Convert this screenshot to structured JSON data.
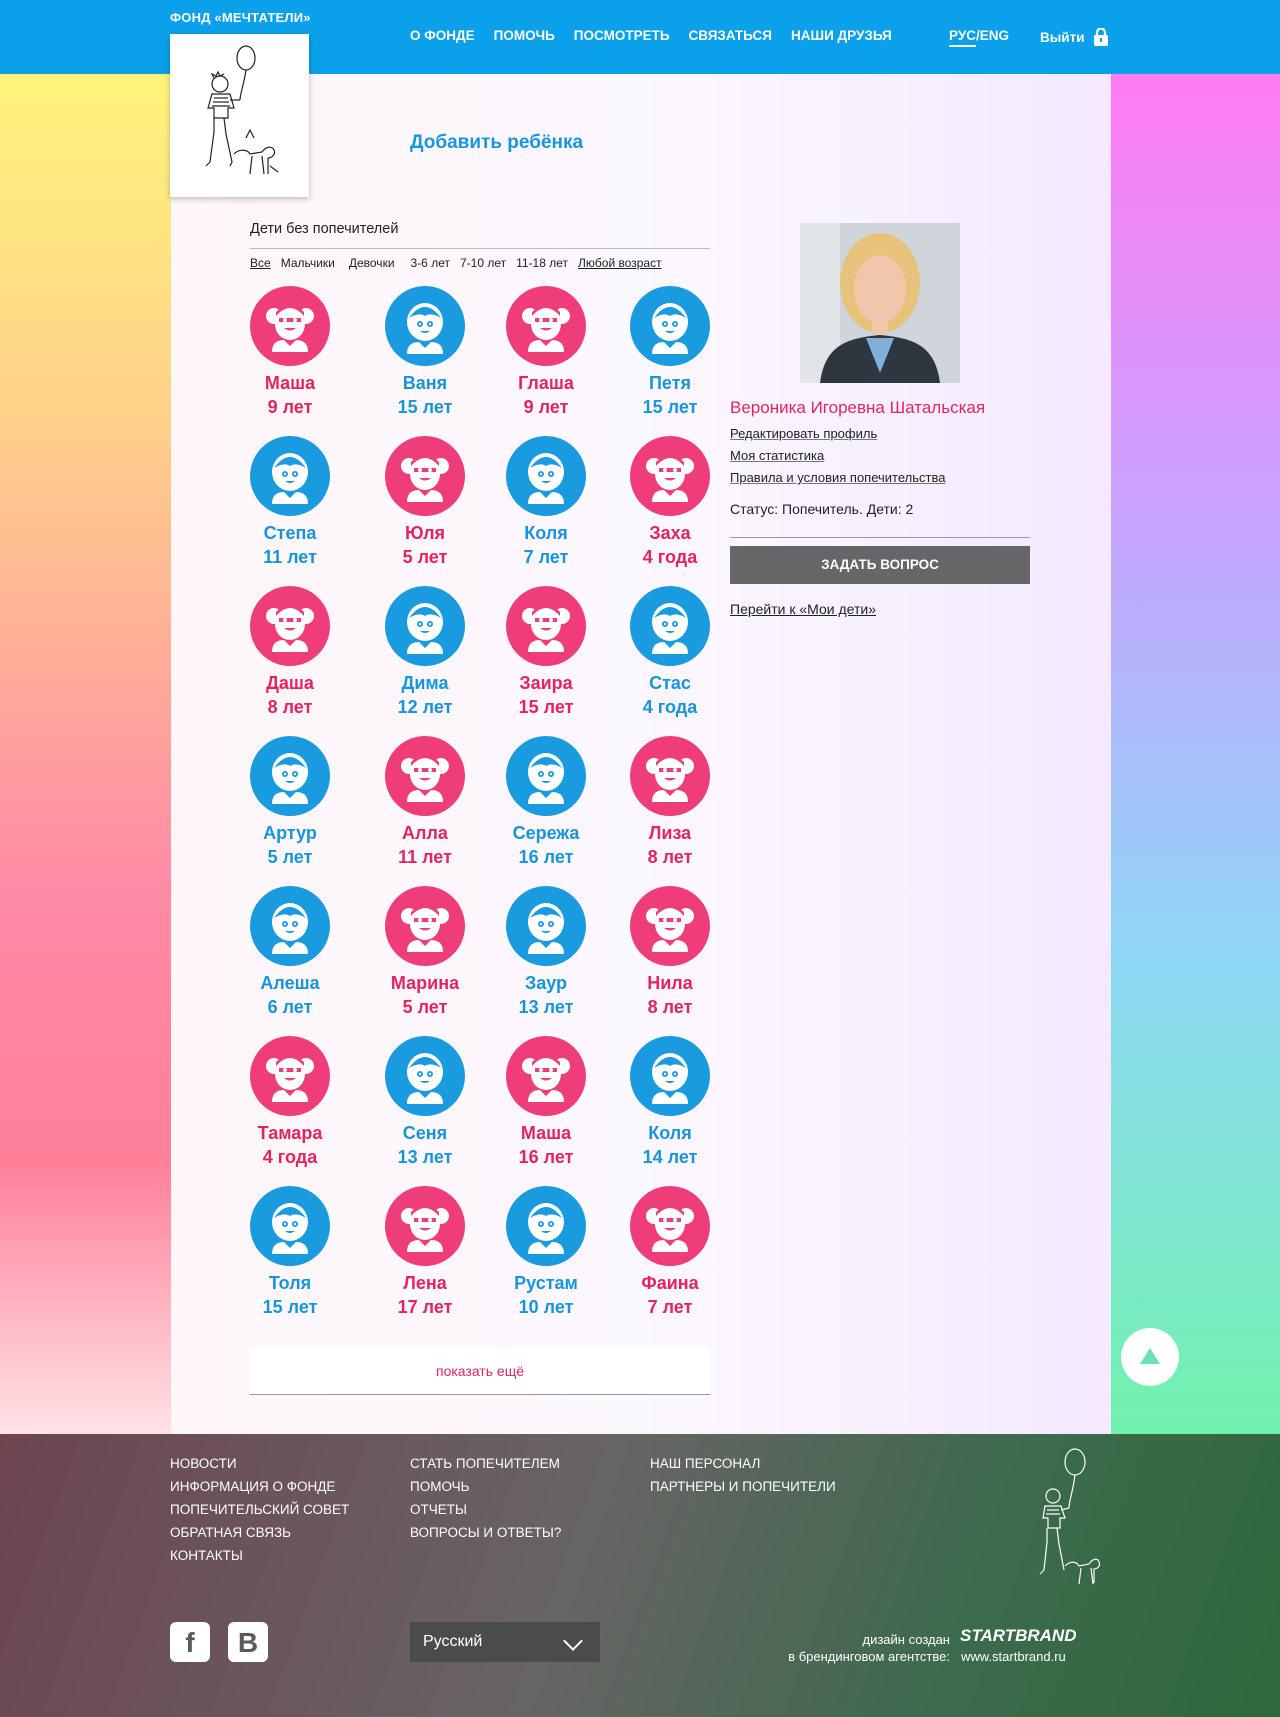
{
  "header": {
    "brand": "ФОНД «МЕЧТАТЕЛИ»",
    "nav": [
      "О ФОНДЕ",
      "ПОМОЧЬ",
      "ПОСМОТРЕТЬ",
      "СВЯЗАТЬСЯ",
      "НАШИ ДРУЗЬЯ"
    ],
    "lang_active": "РУС",
    "lang_sep": "/",
    "lang_other": "ENG",
    "logout": "Выйти"
  },
  "main": {
    "add_child": "Добавить ребёнка",
    "list_title": "Дети без попечителей",
    "filters": [
      "Все",
      "Мальчики",
      "Девочки",
      "3-6 лет",
      "7-10 лет",
      "11-18 лет",
      "Любой возраст"
    ],
    "show_more": "показать ещё"
  },
  "children": [
    {
      "name": "Маша",
      "age": "9 лет",
      "gender": "girl"
    },
    {
      "name": "Ваня",
      "age": "15 лет",
      "gender": "boy"
    },
    {
      "name": "Глаша",
      "age": "9 лет",
      "gender": "girl"
    },
    {
      "name": "Петя",
      "age": "15 лет",
      "gender": "boy"
    },
    {
      "name": "Степа",
      "age": "11 лет",
      "gender": "boy"
    },
    {
      "name": "Юля",
      "age": "5 лет",
      "gender": "girl"
    },
    {
      "name": "Коля",
      "age": "7 лет",
      "gender": "boy"
    },
    {
      "name": "Заха",
      "age": "4 года",
      "gender": "girl"
    },
    {
      "name": "Даша",
      "age": "8 лет",
      "gender": "girl"
    },
    {
      "name": "Дима",
      "age": "12 лет",
      "gender": "boy"
    },
    {
      "name": "Заира",
      "age": "15 лет",
      "gender": "girl"
    },
    {
      "name": "Стас",
      "age": "4 года",
      "gender": "boy"
    },
    {
      "name": "Артур",
      "age": "5 лет",
      "gender": "boy"
    },
    {
      "name": "Алла",
      "age": "11 лет",
      "gender": "girl"
    },
    {
      "name": "Сережа",
      "age": "16 лет",
      "gender": "boy"
    },
    {
      "name": "Лиза",
      "age": "8 лет",
      "gender": "girl"
    },
    {
      "name": "Алеша",
      "age": "6 лет",
      "gender": "boy"
    },
    {
      "name": "Марина",
      "age": "5 лет",
      "gender": "girl"
    },
    {
      "name": "Заур",
      "age": "13 лет",
      "gender": "boy"
    },
    {
      "name": "Нила",
      "age": "8 лет",
      "gender": "girl"
    },
    {
      "name": "Тамара",
      "age": "4 года",
      "gender": "girl"
    },
    {
      "name": "Сеня",
      "age": "13 лет",
      "gender": "boy"
    },
    {
      "name": "Маша",
      "age": "16 лет",
      "gender": "girl"
    },
    {
      "name": "Коля",
      "age": "14 лет",
      "gender": "boy"
    },
    {
      "name": "Толя",
      "age": "15 лет",
      "gender": "boy"
    },
    {
      "name": "Лена",
      "age": "17 лет",
      "gender": "girl"
    },
    {
      "name": "Рустам",
      "age": "10 лет",
      "gender": "boy"
    },
    {
      "name": "Фаина",
      "age": "7 лет",
      "gender": "girl"
    }
  ],
  "profile": {
    "name": "Вероника Игоревна Шатальская",
    "links": [
      "Редактировать профиль",
      "Моя статистика",
      "Правила и условия попечительства"
    ],
    "status": "Статус: Попечитель. Дети: 2",
    "ask_button": "ЗАДАТЬ ВОПРОС",
    "my_kids": "Перейти к «Мои дети»"
  },
  "footer": {
    "col1": [
      "НОВОСТИ",
      "ИНФОРМАЦИЯ О ФОНДЕ",
      "ПОПЕЧИТЕЛЬСКИЙ СОВЕТ",
      "ОБРАТНАЯ СВЯЗЬ",
      "КОНТАКТЫ"
    ],
    "col2": [
      "СТАТЬ ПОПЕЧИТЕЛЕМ",
      "ПОМОЧЬ",
      "ОТЧЕТЫ",
      "ВОПРОСЫ И ОТВЕТЫ?"
    ],
    "col3": [
      "НАШ ПЕРСОНАЛ",
      "ПАРТНЕРЫ И ПОПЕЧИТЕЛИ"
    ],
    "language": "Русский",
    "credit_line1": "дизайн создан",
    "credit_line2": "в брендинговом агентстве:",
    "agency": "STARTBRAND",
    "agency_url": "www.startbrand.ru",
    "social": [
      "facebook-icon",
      "vk-icon"
    ]
  },
  "colors": {
    "accent_blue": "#0aa1ea",
    "girl": "#ef3d7a",
    "boy": "#1a9be0",
    "name_pink": "#e5245f"
  }
}
